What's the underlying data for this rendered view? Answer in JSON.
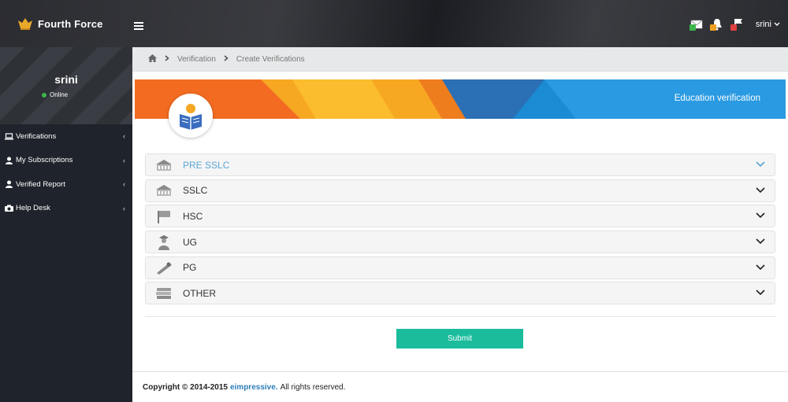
{
  "brand": {
    "name": "Fourth Force"
  },
  "header": {
    "user": "srini",
    "notifications": [
      {
        "icon": "mail-icon",
        "count": "",
        "color": "#3cb54a"
      },
      {
        "icon": "bell-icon",
        "count": "",
        "color": "#f0a020"
      },
      {
        "icon": "flag-icon",
        "count": "",
        "color": "#e04040"
      }
    ]
  },
  "sidebar": {
    "profile": {
      "name": "srini",
      "status": "Online"
    },
    "items": [
      {
        "label": "Verifications",
        "icon": "laptop-icon"
      },
      {
        "label": "My Subscriptions",
        "icon": "user-icon"
      },
      {
        "label": "Verified Report",
        "icon": "user-icon"
      },
      {
        "label": "Help Desk",
        "icon": "camera-icon"
      }
    ]
  },
  "breadcrumb": {
    "items": [
      "Verification",
      "Create Verifications"
    ]
  },
  "banner": {
    "title": "Education verification"
  },
  "accordion": {
    "items": [
      {
        "label": "PRE SSLC",
        "icon": "school-building-icon",
        "active": true
      },
      {
        "label": "SSLC",
        "icon": "school-building-icon",
        "active": false
      },
      {
        "label": "HSC",
        "icon": "flag-board-icon",
        "active": false
      },
      {
        "label": "UG",
        "icon": "graduate-icon",
        "active": false
      },
      {
        "label": "PG",
        "icon": "diploma-icon",
        "active": false
      },
      {
        "label": "OTHER",
        "icon": "books-stack-icon",
        "active": false
      }
    ]
  },
  "form": {
    "submit_label": "Submit"
  },
  "footer": {
    "copyright": "Copyright © 2014-2015",
    "company": "eimpressive.",
    "rights": "All rights reserved."
  },
  "colors": {
    "accent": "#1abc9c",
    "link": "#2d7fb8",
    "active_label": "#5ba6d6"
  }
}
